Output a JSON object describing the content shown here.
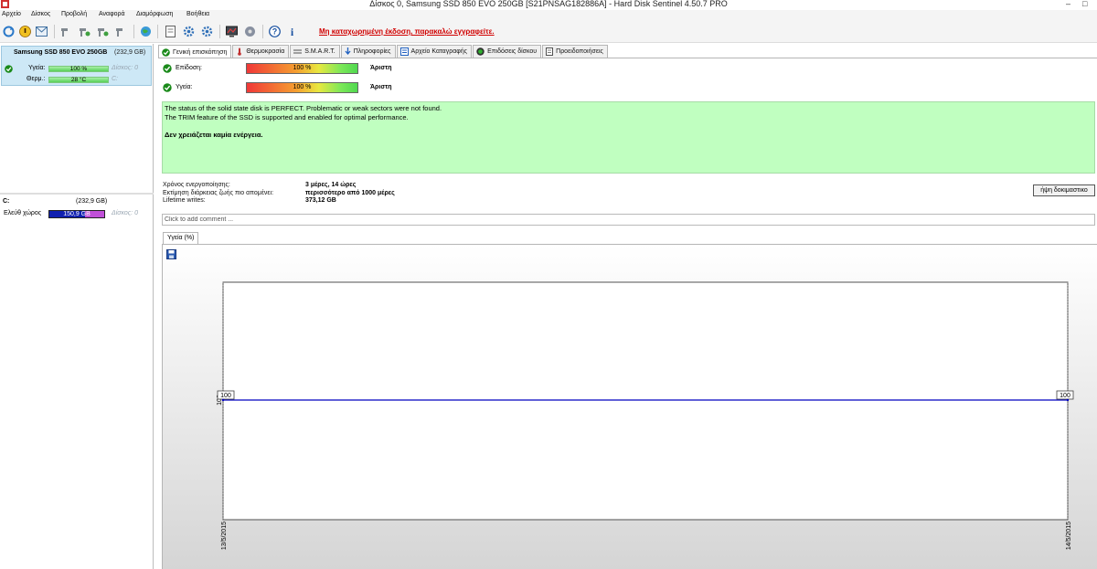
{
  "window": {
    "title": "Δίσκος 0, Samsung SSD 850 EVO 250GB [S21PNSAG182886A]  -  Hard Disk Sentinel 4.50.7 PRO",
    "minimize": "–",
    "maximize": "□"
  },
  "menu": [
    "Αρχείο",
    "Δίσκος",
    "Προβολή",
    "Αναφορά",
    "Διαμόρφωση",
    "Βοήθεια"
  ],
  "toolbar": {
    "icons": [
      "refresh-icon",
      "alert-icon",
      "mail-icon",
      "wrench-icon",
      "wrench-icon",
      "wrench-icon",
      "wrench-icon",
      "globe-icon",
      "document-icon",
      "gear-icon",
      "gear-icon",
      "monitor-icon",
      "settings-icon",
      "help-icon",
      "info-icon"
    ],
    "help_glyph": "?",
    "info_glyph": "i",
    "warning": "Μη καταχωρημένη έκδοση, παρακαλώ εγγραφείτε."
  },
  "disk_card": {
    "name": "Samsung SSD 850 EVO 250GB",
    "size": "(232,9 GB)",
    "health_label": "Υγεία:",
    "health_value": "100 %",
    "health_percent": 100,
    "temp_label": "Θερμ.:",
    "temp_value": "28 °C",
    "temp_fill": 100,
    "disk_id": "Δίσκος: 0",
    "drive_letter": "C:"
  },
  "partition": {
    "letter": "C:",
    "size": "(232,9 GB)",
    "free_label": "Ελεύθ χώρος",
    "free_value": "150,9 GB",
    "free_fraction": 0.648,
    "disk_id": "Δίσκος: 0"
  },
  "tabs": [
    {
      "label": "Γενική επισκόπηση",
      "icon": "check-icon",
      "color": "#1a8a1a",
      "active": true
    },
    {
      "label": "Θερμοκρασία",
      "icon": "thermometer-icon",
      "color": "#c03030",
      "active": false
    },
    {
      "label": "S.M.A.R.T.",
      "icon": "list-icon",
      "color": "#505050",
      "active": false
    },
    {
      "label": "Πληροφορίες",
      "icon": "info-icon",
      "color": "#2060c0",
      "active": false
    },
    {
      "label": "Αρχείο Καταγραφής",
      "icon": "log-icon",
      "color": "#2060c0",
      "active": false
    },
    {
      "label": "Επιδόσεις δίσκου",
      "icon": "performance-icon",
      "color": "#20a020",
      "active": false
    },
    {
      "label": "Προειδοποιήσεις",
      "icon": "document-icon",
      "color": "#505050",
      "active": false
    }
  ],
  "overview": {
    "performance": {
      "label": "Επίδοση:",
      "value": "100 %",
      "percent": 100,
      "rating": "Άριστη"
    },
    "health": {
      "label": "Υγεία:",
      "value": "100 %",
      "percent": 100,
      "rating": "Άριστη"
    },
    "status_lines": [
      "The status of the solid state disk is PERFECT. Problematic or weak sectors were not found.",
      "The TRIM feature of the SSD is supported and enabled for optimal performance."
    ],
    "action": "Δεν χρειάζεται καμία ενέργεια.",
    "info": [
      {
        "key": "Χρόνος ενεργοποίησης:",
        "value": "3 μέρες, 14 ώρες"
      },
      {
        "key": "Εκτίμηση διάρκειας ζωής πιο απομένει:",
        "value": "περισσότερο από 1000 μέρες"
      },
      {
        "key": "Lifetime writes:",
        "value": "373,12 GB"
      }
    ],
    "test_button": "ήψη δοκιμαστικο",
    "comment_placeholder": "Click to add comment ..."
  },
  "chart_tab": "Υγεία (%)",
  "chart_data": {
    "type": "line",
    "title": "",
    "xlabel": "",
    "ylabel": "",
    "x": [
      "13/5/2015",
      "14/5/2015"
    ],
    "series": [
      {
        "values": [
          100,
          100
        ],
        "color": "#0000c0"
      }
    ],
    "point_labels": [
      "100",
      "100"
    ],
    "ytick": "100"
  }
}
